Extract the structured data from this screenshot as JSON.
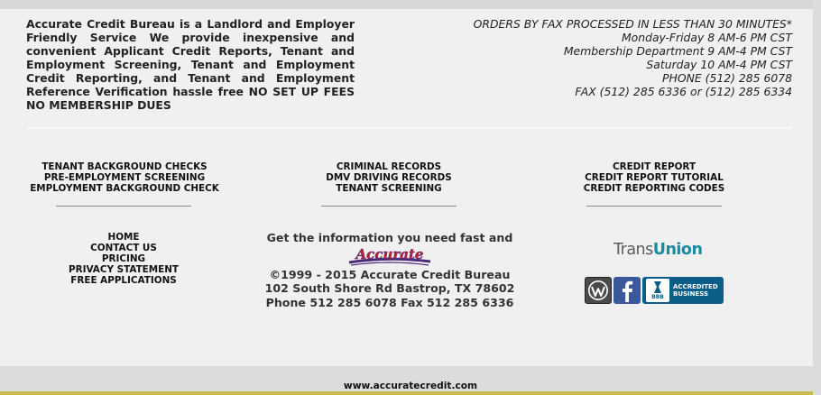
{
  "about": {
    "text": "Accurate Credit Bureau is a Landlord and Employer Friendly Service We provide inexpensive and convenient Applicant Credit Reports, Tenant and Employment Screening, Tenant and Employment Credit Reporting, and Tenant and Employment Reference Verification hassle free NO SET UP FEES NO MEMBERSHIP DUES"
  },
  "hours": {
    "lines": [
      "ORDERS BY FAX PROCESSED IN LESS THAN 30 MINUTES*",
      "Monday-Friday 8 AM-6 PM CST",
      "Membership Department 9 AM-4 PM CST",
      "Saturday 10 AM-4 PM CST",
      "PHONE (512) 285 6078",
      "FAX (512) 285 6336 or (512) 285 6334"
    ]
  },
  "services": {
    "col1": [
      "TENANT BACKGROUND CHECKS",
      "PRE-EMPLOYMENT SCREENING",
      "EMPLOYMENT BACKGROUND CHECK"
    ],
    "col2": [
      "CRIMINAL RECORDS",
      "DMV DRIVING RECORDS",
      "TENANT SCREENING"
    ],
    "col3": [
      "CREDIT REPORT",
      "CREDIT REPORT TUTORIAL",
      "CREDIT REPORTING CODES"
    ]
  },
  "nav": [
    "HOME",
    "CONTACT US",
    "PRICING",
    "PRIVACY STATEMENT",
    "FREE APPLICATIONS"
  ],
  "center": {
    "tagline": "Get the information you need fast and",
    "logo_text": "Accurate",
    "copyright": "©1999 - 2015 Accurate Credit Bureau",
    "address": "102 South Shore Rd Bastrop, TX 78602",
    "phones": "Phone 512 285 6078 Fax 512 285 6336"
  },
  "partners": {
    "transunion_trans": "Trans",
    "transunion_union": "Union",
    "bbb_mark": "BBB",
    "bbb_line1": "ACCREDITED",
    "bbb_line2": "BUSINESS"
  },
  "footer": {
    "url": "www.accuratecredit.com"
  },
  "colors": {
    "accent_red": "#c41e2a",
    "accent_purple": "#4b2a7b",
    "transunion_teal": "#1c8aa0",
    "facebook": "#3b5998",
    "bbb_blue": "#0a5e88",
    "footer_stripe": "#c9b955"
  }
}
